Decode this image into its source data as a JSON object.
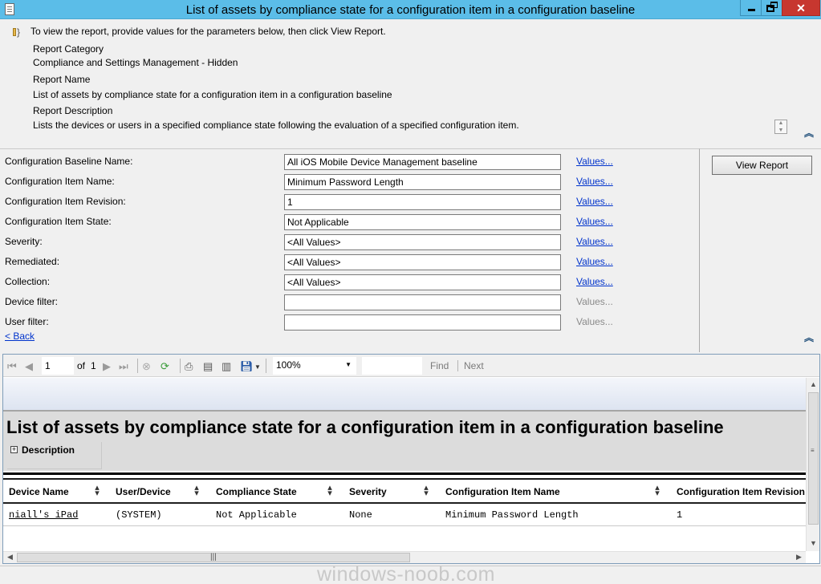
{
  "window": {
    "title": "List of assets by compliance state for a configuration item in a configuration baseline"
  },
  "info": {
    "instruction": "To view the report, provide values for the parameters below, then click View Report.",
    "category_label": "Report Category",
    "category_value": "Compliance and Settings Management - Hidden",
    "name_label": "Report Name",
    "name_value": "List of assets by compliance state for a configuration item in a configuration baseline",
    "description_label": "Report Description",
    "description_value": "Lists the devices or users in a specified compliance state following the evaluation of a specified configuration item."
  },
  "params": [
    {
      "label": "Configuration Baseline Name:",
      "value": "All iOS Mobile Device Management baseline",
      "link": "Values..."
    },
    {
      "label": "Configuration Item Name:",
      "value": "Minimum Password Length",
      "link": "Values..."
    },
    {
      "label": "Configuration Item Revision:",
      "value": "1",
      "link": "Values..."
    },
    {
      "label": "Configuration Item State:",
      "value": "Not Applicable",
      "link": "Values..."
    },
    {
      "label": "Severity:",
      "value": "<All Values>",
      "link": "Values..."
    },
    {
      "label": "Remediated:",
      "value": "<All Values>",
      "link": "Values..."
    },
    {
      "label": "Collection:",
      "value": "<All Values>",
      "link": "Values..."
    },
    {
      "label": "Device filter:",
      "value": "",
      "link": "Values..."
    },
    {
      "label": "User filter:",
      "value": "",
      "link": "Values..."
    }
  ],
  "back_link": "< Back",
  "view_report_button": "View Report",
  "toolbar": {
    "page": "1",
    "of_label": "of",
    "total_pages": "1",
    "zoom": "100%",
    "find_text": "",
    "find_label": "Find",
    "next_label": "Next"
  },
  "report": {
    "title": "List of assets by compliance state for a configuration item in a configuration baseline",
    "description_label": "Description",
    "columns": [
      "Device Name",
      "User/Device",
      "Compliance State",
      "Severity",
      "Configuration Item Name",
      "Configuration Item Revision"
    ],
    "rows": [
      [
        "niall's iPad",
        "(SYSTEM)",
        "Not Applicable",
        "None",
        "Minimum Password Length",
        "1"
      ]
    ]
  },
  "watermark": "windows-noob.com",
  "colors": {
    "titlebar": "#5bbde8",
    "close": "#c7372f",
    "link": "#0033cc"
  }
}
